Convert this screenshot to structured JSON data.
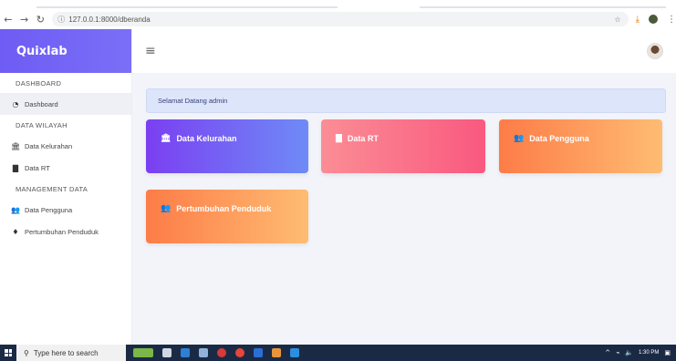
{
  "browser": {
    "url": "127.0.0.1:8000/dberanda",
    "back_icon": "arrow-left-icon",
    "forward_icon": "arrow-right-icon",
    "reload_icon": "reload-icon"
  },
  "brand": {
    "name": "Quixlab"
  },
  "sidebar": {
    "sections": [
      {
        "title": "DASHBOARD",
        "items": [
          {
            "label": "Dashboard",
            "icon": "dashboard-icon",
            "active": true
          }
        ]
      },
      {
        "title": "DATA WILAYAH",
        "items": [
          {
            "label": "Data Kelurahan",
            "icon": "building-icon"
          },
          {
            "label": "Data RT",
            "icon": "document-icon"
          }
        ]
      },
      {
        "title": "MANAGEMENT DATA",
        "items": [
          {
            "label": "Data Pengguna",
            "icon": "users-icon"
          },
          {
            "label": "Pertumbuhan Penduduk",
            "icon": "person-icon"
          }
        ]
      }
    ]
  },
  "welcome": {
    "text": "Selamat Datang admin"
  },
  "cards": [
    {
      "label": "Data Kelurahan",
      "icon": "building-icon"
    },
    {
      "label": "Data RT",
      "icon": "document-icon"
    },
    {
      "label": "Data Pengguna",
      "icon": "users-icon"
    },
    {
      "label": "Pertumbuhan Penduduk",
      "icon": "users-icon"
    }
  ],
  "taskbar": {
    "search_placeholder": "Type here to search",
    "time": "1:30 PM"
  },
  "colors": {
    "brand": "#6f5cf4",
    "card1": "#7b3ff2",
    "card2": "#f9597f",
    "card3": "#fd7c47",
    "welcome_bg": "#dde5fb"
  }
}
